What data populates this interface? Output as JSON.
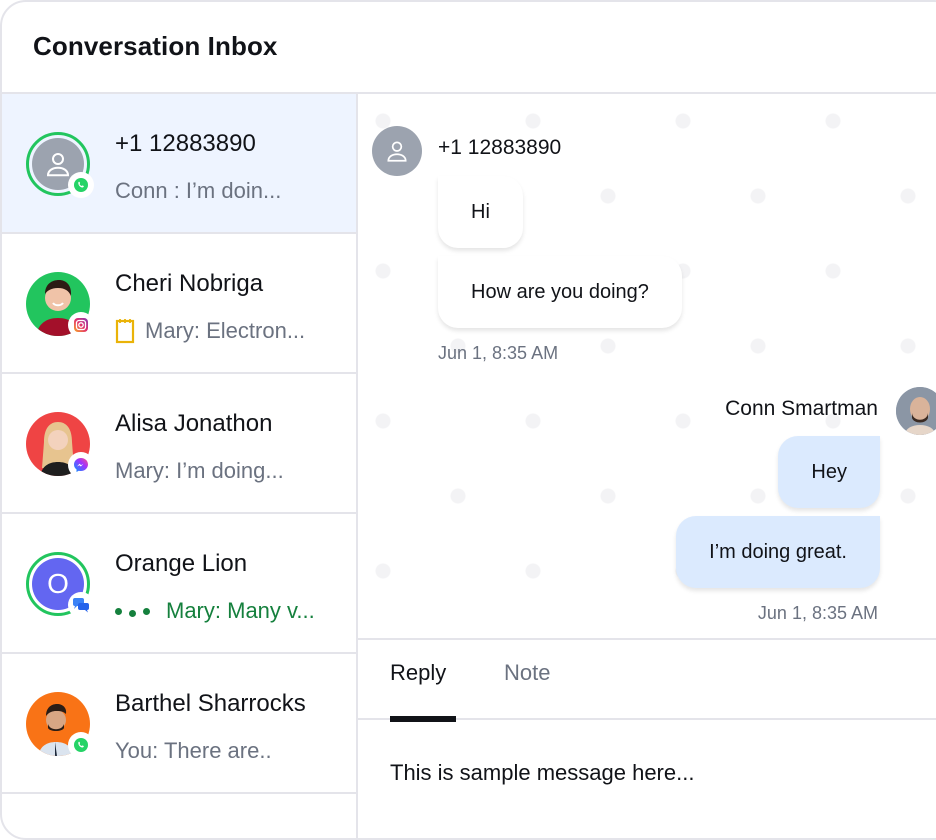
{
  "header": {
    "title": "Conversation Inbox"
  },
  "colors": {
    "active_row_bg": "#eef4ff",
    "online_ring": "#22c55e",
    "outgoing_bubble": "#dbeafe",
    "typing_green": "#15803d",
    "border": "#e4e4ea"
  },
  "conversations": [
    {
      "name": "+1 12883890",
      "preview": "Conn : I’m doin...",
      "channel": "whatsapp",
      "avatar": "default-user",
      "online": true,
      "active": true
    },
    {
      "name": "Cheri Nobriga",
      "preview": "Mary: Electron...",
      "channel": "instagram",
      "avatar": "photo",
      "avatar_bg": "#22c55e",
      "preview_icon": "note-icon",
      "online": false
    },
    {
      "name": "Alisa Jonathon",
      "preview": "Mary: I’m doing...",
      "channel": "messenger",
      "avatar": "photo",
      "avatar_bg": "#ef4444",
      "online": false
    },
    {
      "name": "Orange Lion",
      "preview": "Mary: Many v...",
      "channel": "live-chat",
      "avatar": "initial",
      "initial": "O",
      "avatar_bg": "#6366f1",
      "typing": true,
      "online": true
    },
    {
      "name": "Barthel Sharrocks",
      "preview": "You: There are..",
      "channel": "whatsapp",
      "avatar": "photo",
      "avatar_bg": "#f97316",
      "online": false
    }
  ],
  "chat": {
    "incoming": {
      "sender": "+1 12883890",
      "messages": [
        "Hi",
        "How are you doing?"
      ],
      "timestamp": "Jun 1, 8:35 AM"
    },
    "outgoing": {
      "sender": "Conn Smartman",
      "messages": [
        "Hey",
        "I’m doing great."
      ],
      "timestamp": "Jun 1, 8:35 AM"
    }
  },
  "composer": {
    "tabs": [
      {
        "label": "Reply",
        "active": true
      },
      {
        "label": "Note",
        "active": false
      }
    ],
    "value": "This is sample message here..."
  }
}
